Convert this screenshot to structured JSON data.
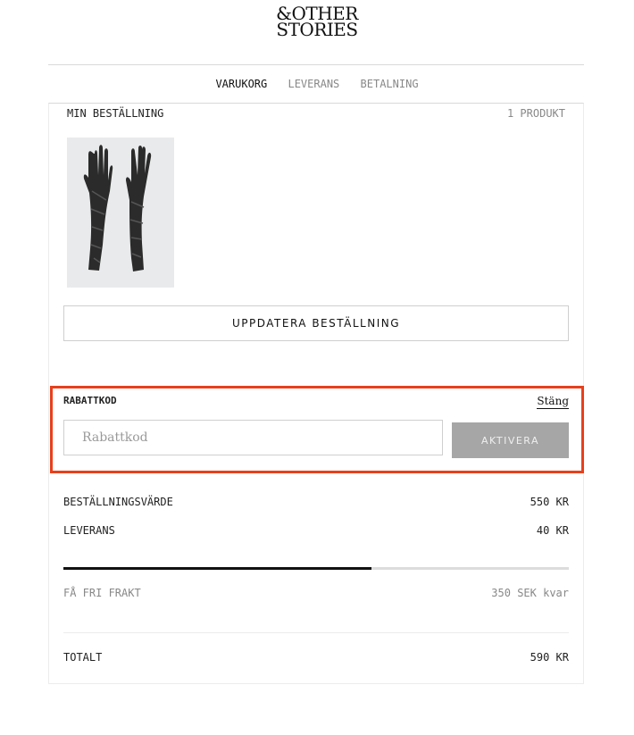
{
  "brand": {
    "line1": "&OTHER",
    "line2": "STORIES"
  },
  "steps": [
    {
      "label": "VARUKORG",
      "active": true
    },
    {
      "label": "LEVERANS",
      "active": false
    },
    {
      "label": "BETALNING",
      "active": false
    }
  ],
  "order": {
    "heading": "MIN BESTÄLLNING",
    "count": "1 PRODUKT",
    "update_label": "UPPDATERA BESTÄLLNING"
  },
  "coupon": {
    "label": "RABATTKOD",
    "close_label": "Stäng",
    "placeholder": "Rabattkod",
    "value": "",
    "activate_label": "AKTIVERA"
  },
  "summary": {
    "order_value_label": "BESTÄLLNINGSVÄRDE",
    "order_value": "550 KR",
    "delivery_label": "LEVERANS",
    "delivery_value": "40 KR",
    "free_shipping_progress": 0.61,
    "free_shipping_label": "FÅ FRI FRAKT",
    "free_shipping_remaining": "350 SEK kvar",
    "total_label": "TOTALT",
    "total_value": "590 KR"
  },
  "colors": {
    "highlight": "#e8401c",
    "button_disabled": "#a6a6a6"
  }
}
